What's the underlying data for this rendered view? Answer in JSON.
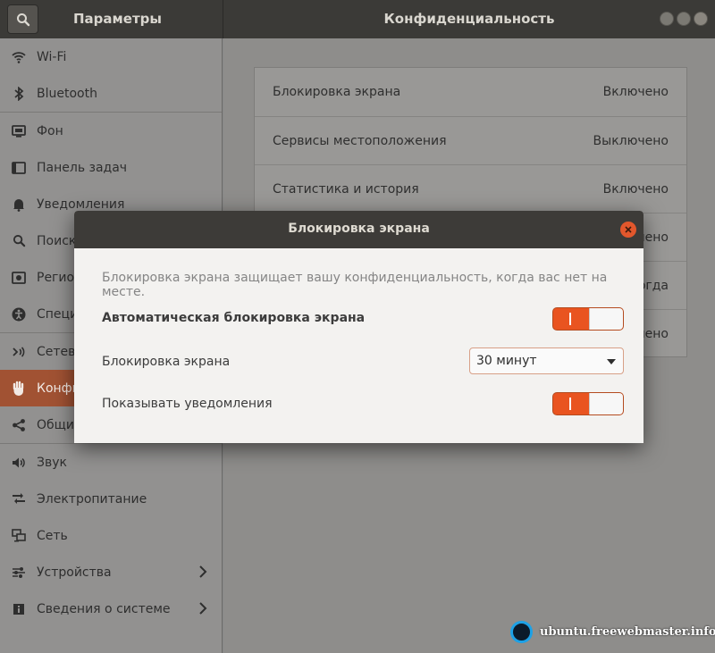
{
  "header": {
    "search_icon": "search-icon",
    "left_title": "Параметры",
    "center_title": "Конфиденциальность"
  },
  "sidebar": {
    "items": [
      {
        "label": "Wi-Fi",
        "icon": "wifi-icon"
      },
      {
        "label": "Bluetooth",
        "icon": "bluetooth-icon"
      },
      {
        "label": "Фон",
        "icon": "background-icon"
      },
      {
        "label": "Панель задач",
        "icon": "dock-icon"
      },
      {
        "label": "Уведомления",
        "icon": "bell-icon"
      },
      {
        "label": "Поиск",
        "icon": "search-icon"
      },
      {
        "label": "Регион",
        "icon": "region-icon"
      },
      {
        "label": "Специальные возможности",
        "icon": "accessibility-icon"
      },
      {
        "label": "Сетевые учетные записи",
        "icon": "online-accounts-icon"
      },
      {
        "label": "Конфиденциальность",
        "icon": "hand-icon",
        "active": true
      },
      {
        "label": "Общий доступ",
        "icon": "share-icon"
      },
      {
        "label": "Звук",
        "icon": "speaker-icon"
      },
      {
        "label": "Электропитание",
        "icon": "power-icon"
      },
      {
        "label": "Сеть",
        "icon": "network-icon"
      },
      {
        "label": "Устройства",
        "icon": "devices-icon",
        "chevron": true
      },
      {
        "label": "Сведения о системе",
        "icon": "info-icon",
        "chevron": true
      }
    ]
  },
  "privacy": {
    "rows": [
      {
        "name": "Блокировка экрана",
        "value": "Включено"
      },
      {
        "name": "Сервисы местоположения",
        "value": "Выключено"
      },
      {
        "name": "Статистика и история",
        "value": "Включено"
      },
      {
        "name": "",
        "value": "Выключено"
      },
      {
        "name": "",
        "value": "Никогда"
      },
      {
        "name": "",
        "value": "Выключено"
      }
    ]
  },
  "dialog": {
    "title": "Блокировка экрана",
    "description": "Блокировка экрана защищает вашу конфиденциальность, когда вас нет на месте.",
    "auto_lock_label": "Автоматическая блокировка экрана",
    "auto_lock_on": true,
    "lock_delay_label": "Блокировка экрана",
    "lock_delay_value": "30 минут",
    "show_notifications_label": "Показывать уведомления",
    "show_notifications_on": true
  },
  "watermark": {
    "text": "ubuntu.freewebmaster.info"
  },
  "colors": {
    "accent": "#e95420",
    "active_sidebar": "#a15233",
    "header": "#3b3a37"
  }
}
